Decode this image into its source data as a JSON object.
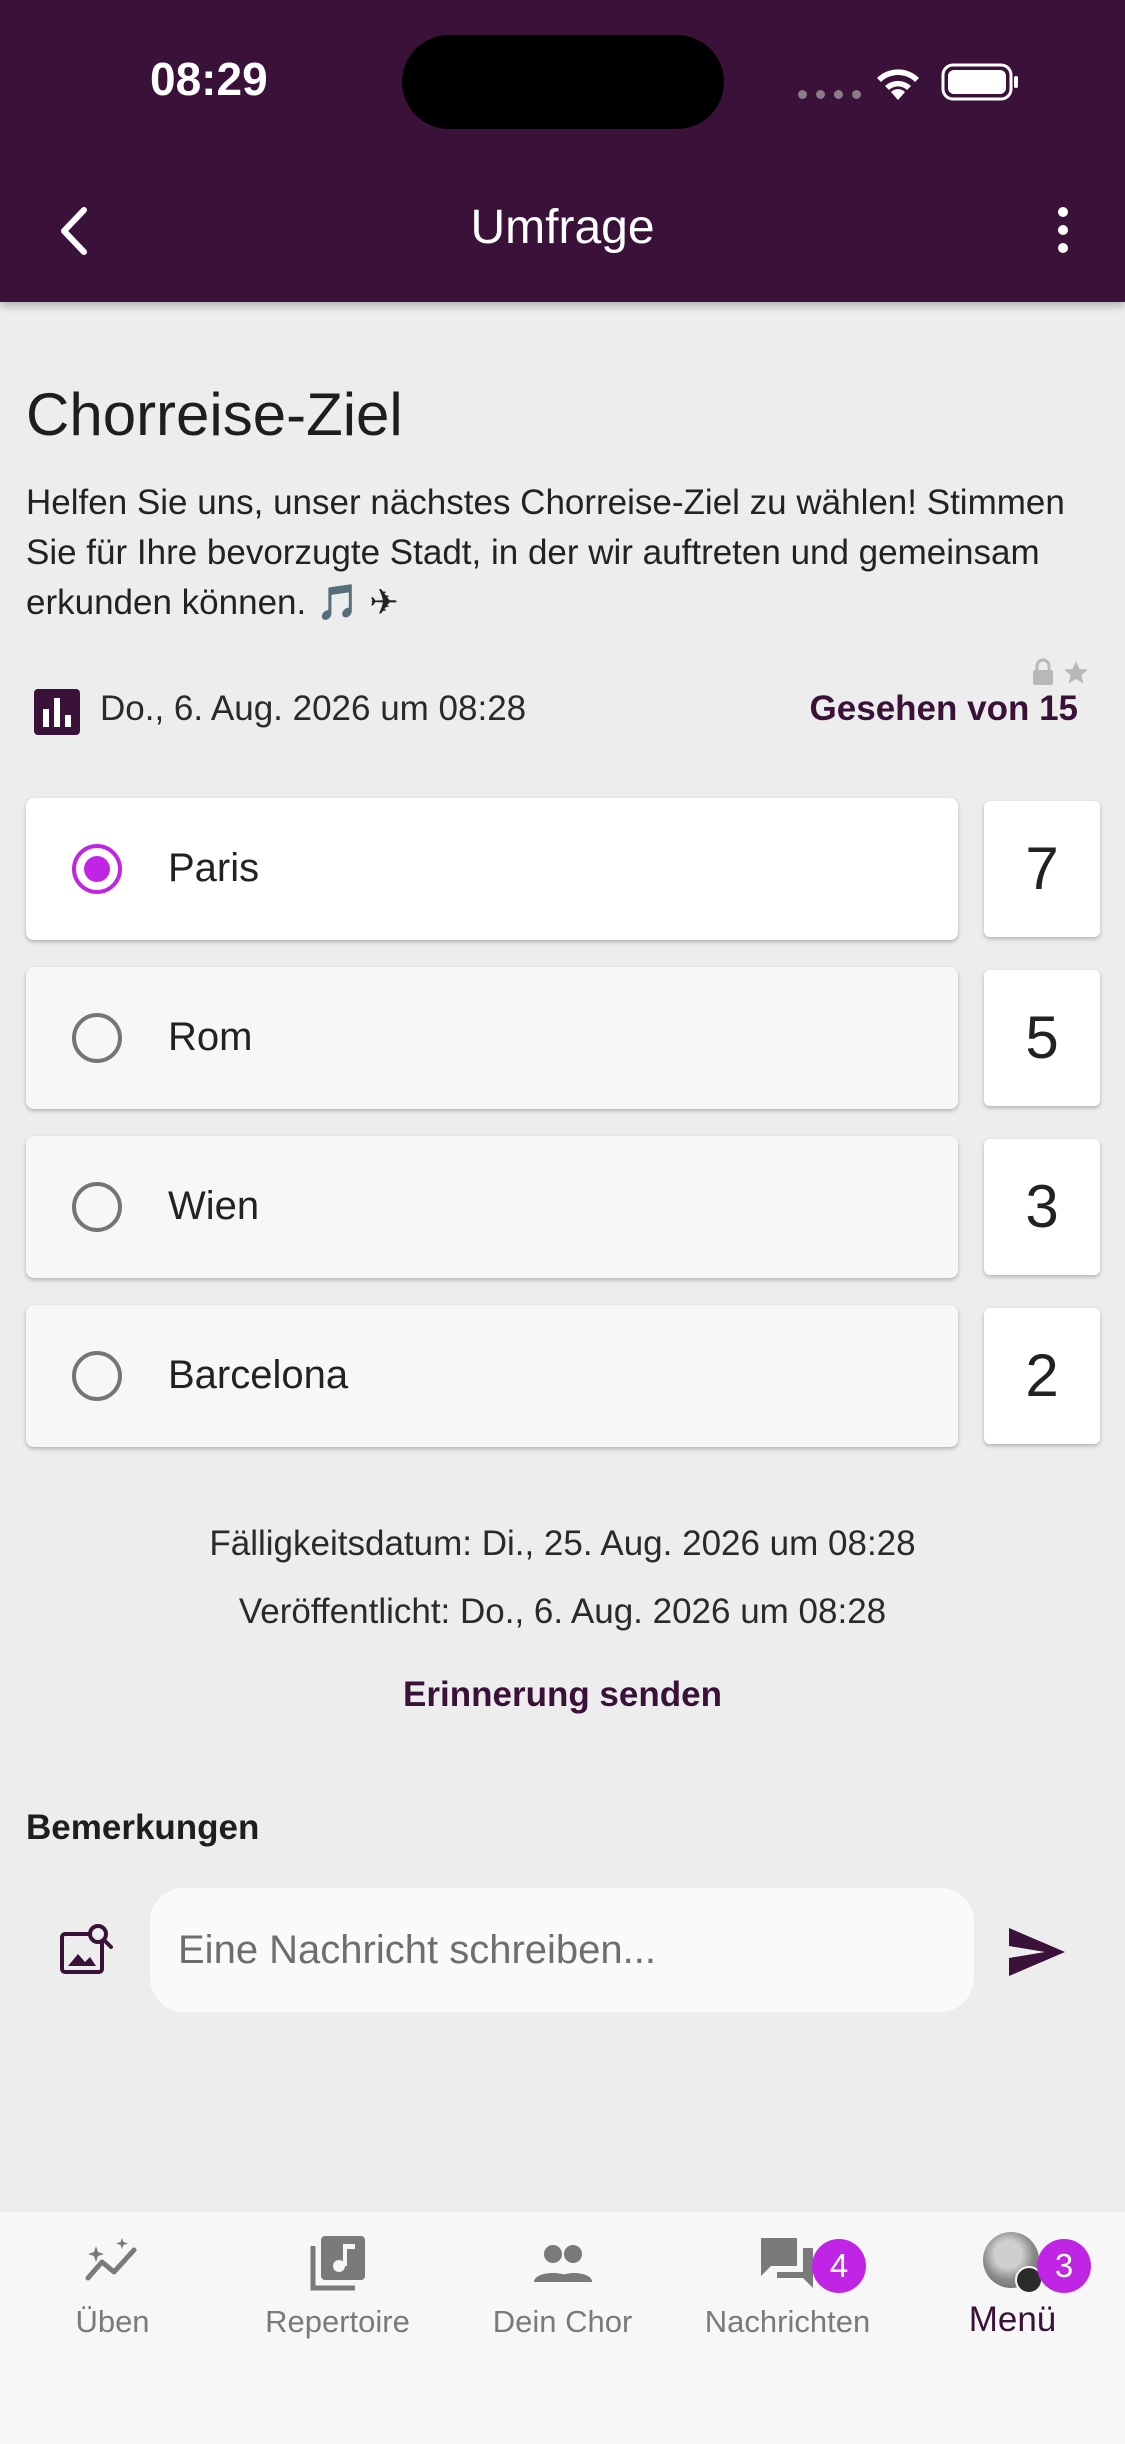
{
  "status_bar": {
    "time": "08:29"
  },
  "header": {
    "title": "Umfrage"
  },
  "poll": {
    "title": "Chorreise-Ziel",
    "description": "Helfen Sie uns, unser nächstes Chorreise-Ziel zu wählen! Stimmen Sie für Ihre bevorzugte Stadt, in der wir auftreten und gemeinsam erkunden können. 🎵 ✈",
    "created": "Do., 6. Aug. 2026 um 08:28",
    "seen_by": "Gesehen von 15",
    "options": [
      {
        "label": "Paris",
        "count": "7",
        "selected": true
      },
      {
        "label": "Rom",
        "count": "5",
        "selected": false
      },
      {
        "label": "Wien",
        "count": "3",
        "selected": false
      },
      {
        "label": "Barcelona",
        "count": "2",
        "selected": false
      }
    ],
    "due_date": "Fälligkeitsdatum: Di., 25. Aug. 2026 um 08:28",
    "published": "Veröffentlicht: Do., 6. Aug. 2026 um 08:28",
    "reminder_label": "Erinnerung senden"
  },
  "remarks": {
    "label": "Bemerkungen",
    "input_placeholder": "Eine Nachricht schreiben...",
    "input_value": ""
  },
  "bottom_nav": {
    "items": [
      {
        "label": "Üben",
        "icon": "practice-chart-icon"
      },
      {
        "label": "Repertoire",
        "icon": "music-library-icon"
      },
      {
        "label": "Dein Chor",
        "icon": "people-icon"
      },
      {
        "label": "Nachrichten",
        "icon": "chat-icon",
        "badge": "4"
      },
      {
        "label": "Menü",
        "icon": "avatar",
        "badge": "3",
        "active": true
      }
    ]
  },
  "colors": {
    "primary": "#3a1138",
    "accent": "#c025e6",
    "background": "#ededed"
  }
}
